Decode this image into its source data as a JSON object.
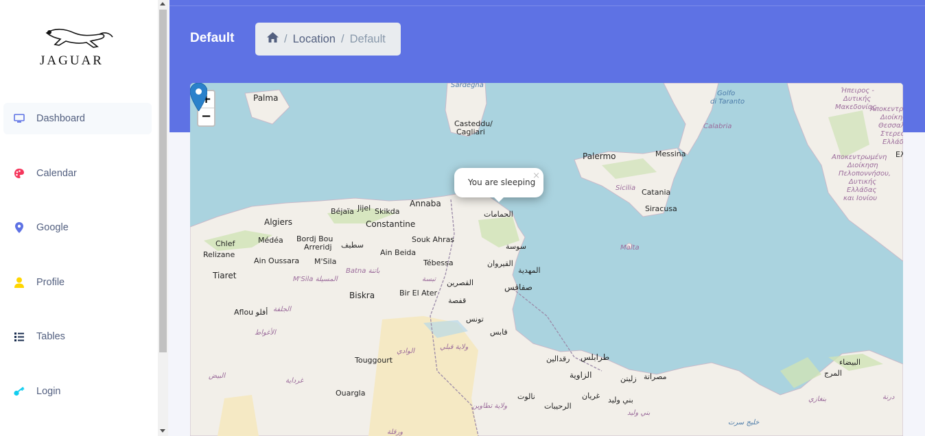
{
  "brand": {
    "name": "JAGUAR"
  },
  "sidebar": {
    "items": [
      {
        "label": "Dashboard",
        "icon": "monitor-icon",
        "color": "#5e72e4",
        "active": true
      },
      {
        "label": "Calendar",
        "icon": "palette-icon",
        "color": "#f5365c"
      },
      {
        "label": "Google",
        "icon": "map-pin-icon",
        "color": "#5e72e4"
      },
      {
        "label": "Profile",
        "icon": "user-icon",
        "color": "#ffd600"
      },
      {
        "label": "Tables",
        "icon": "list-icon",
        "color": "#172b4d"
      },
      {
        "label": "Login",
        "icon": "key-icon",
        "color": "#11cdef"
      }
    ]
  },
  "header": {
    "title": "Default",
    "breadcrumb": {
      "home_icon": "home-icon",
      "items": [
        "Location",
        "Default"
      ]
    },
    "color": "#5e72e4"
  },
  "map": {
    "zoom_in": "+",
    "zoom_out": "−",
    "popup": {
      "text": "You are sleeping",
      "close": "×"
    },
    "marker_color": "#2a81cb",
    "labels": {
      "palma": "Palma",
      "sardegna": "Sardegna",
      "casteddu": "Casteddu/",
      "cagliari": "Cagliari",
      "golfo1": "Golfo",
      "golfo2": "di Taranto",
      "calabria": "Calabria",
      "palermo": "Palermo",
      "messina": "Messina",
      "sicilia": "Sicilia",
      "catania": "Catania",
      "siracusa": "Siracusa",
      "malta": "Malta",
      "annaba": "Annaba",
      "bejaia": "Béjaïa",
      "jijel": "Jijel",
      "skikda": "Skikda",
      "algiers": "Algiers",
      "constantine": "Constantine",
      "chlef": "Chlef",
      "medea": "Médéa",
      "bordj1": "Bordj Bou",
      "bordj2": "Arreridj",
      "setif": "سطيف",
      "soukahras": "Souk Ahras",
      "relizane": "Relizane",
      "ainoussara": "Ain Oussara",
      "msila": "M'Sila",
      "ainbeida": "Ain Beida",
      "tebessa": "Tébessa",
      "tiaret": "Tiaret",
      "msila2": "M'Sila المسيلة",
      "batna": "Batna باتنة",
      "tebessa_ar": "تبسة",
      "kasserine": "القصرين",
      "biskra": "Biskra",
      "birelater": "Bir El Ater",
      "gafsa": "قفصة",
      "tunis": "تونس",
      "aflou": "Aflou أفلو",
      "djelfa": "الجلفة",
      "laghouat": "الأغواط",
      "elouadi": "الوادي",
      "kebili": "ولاية قبلي",
      "touggourt": "Touggourt",
      "elbayadh": "البيض",
      "ghardaia": "غرداية",
      "ouargla": "Ouargla",
      "ouargla_ar": "ورقلة",
      "tataouine": "ولاية تطاوين",
      "sousse": "سوسة",
      "kairouan": "القيروان",
      "mahdia": "المهدية",
      "sfax": "صفاقس",
      "gabes": "قابس",
      "hammamet": "الحمامات",
      "tripoli": "طرابلس",
      "zawiya": "الزاوية",
      "riqdalin": "رقدالين",
      "zliten": "زليتن",
      "misrata": "مصراتة",
      "gharyan": "غريان",
      "nalut": "نالوت",
      "baniwalid": "بني وليد",
      "baniwalid2": "بني وليد",
      "rahibat": "الرحيبات",
      "sirte": "خليج سرت",
      "bayda": "البيضاء",
      "marj": "المرج",
      "derna": "درنة",
      "benghazi": "بنغازي",
      "greece1": "Ήπειρος -",
      "greece2": "Δυτικής",
      "greece3": "Μακεδονίας",
      "greece4": "Αποκεντρ",
      "greece5": "Διοίκησ",
      "greece6": "Θεσσαλ",
      "greece7": "Στερεά",
      "greece8": "Ελλάδα",
      "greece9": "Αποκεντρωμένη",
      "greece10": "Διοίκηση",
      "greece11": "Πελοποννήσου,",
      "greece12": "Δυτικής",
      "greece13": "Ελλάδας",
      "greece14": "και Ιονίου",
      "greece15": "Ελ"
    }
  }
}
